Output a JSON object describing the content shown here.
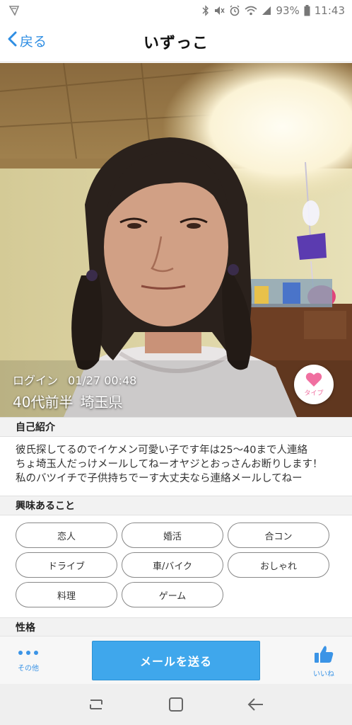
{
  "status_bar": {
    "battery": "93%",
    "time": "11:43"
  },
  "header": {
    "back_label": "戻る",
    "title": "いずっこ"
  },
  "profile": {
    "login_label": "ログイン",
    "login_time": "01/27 00:48",
    "age": "40代前半",
    "location": "埼玉県",
    "type_label": "タイプ"
  },
  "intro": {
    "heading": "自己紹介",
    "lines": [
      "彼氏探してるのでイケメン可愛い子です年は25〜40まで人連絡",
      "ちょ埼玉人だっけメールしてねーオヤジとおっさんお断りします！",
      "私のバツイチで子供持ちでーす大丈夫なら連絡メールしてねー"
    ]
  },
  "interests": {
    "heading": "興味あること",
    "items": [
      "恋人",
      "婚活",
      "合コン",
      "ドライブ",
      "車/バイク",
      "おしゃれ",
      "料理",
      "ゲーム"
    ]
  },
  "personality": {
    "heading": "性格"
  },
  "action_bar": {
    "other_label": "その他",
    "send_mail_label": "メールを送る",
    "like_label": "いいね"
  },
  "colors": {
    "accent": "#3fa7ec",
    "link": "#2f8ee3",
    "heart": "#f06fa0"
  }
}
